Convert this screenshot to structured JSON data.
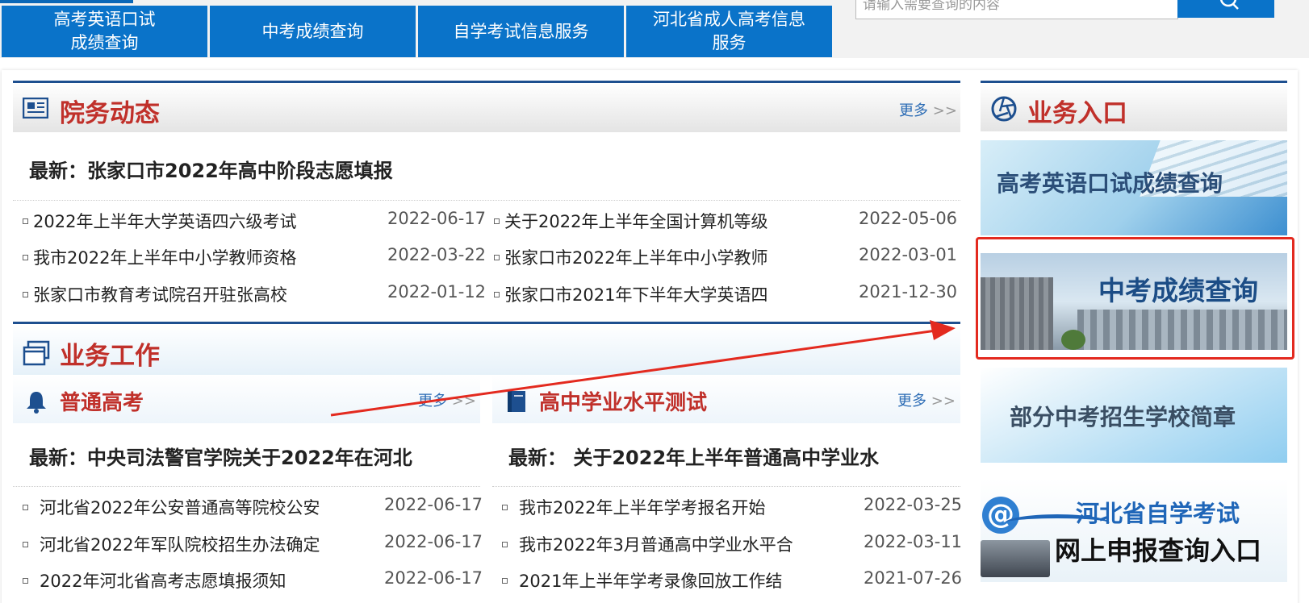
{
  "nav": {
    "items": [
      {
        "label_line1": "高考英语口试",
        "label_line2": "成绩查询"
      },
      {
        "label_line1": "中考成绩查询",
        "label_line2": ""
      },
      {
        "label_line1": "自学考试信息服务",
        "label_line2": ""
      },
      {
        "label_line1": "河北省成人高考信息",
        "label_line2": "服务"
      }
    ],
    "search_placeholder": "请输入需要查询的内容"
  },
  "news_section": {
    "title": "院务动态",
    "more": "更多",
    "latest": "最新：张家口市2022年高中阶段志愿填报",
    "items": [
      {
        "title": "2022年上半年大学英语四六级考试",
        "date": "2022-06-17"
      },
      {
        "title": "关于2022年上半年全国计算机等级",
        "date": "2022-05-06"
      },
      {
        "title": "我市2022年上半年中小学教师资格",
        "date": "2022-03-22"
      },
      {
        "title": "张家口市2022年上半年中小学教师",
        "date": "2022-03-01"
      },
      {
        "title": "张家口市教育考试院召开驻张高校",
        "date": "2022-01-12"
      },
      {
        "title": "张家口市2021年下半年大学英语四",
        "date": "2021-12-30"
      }
    ]
  },
  "work_section": {
    "title": "业务工作",
    "gaokao": {
      "title": "普通高考",
      "more": "更多",
      "latest": "最新：中央司法警官学院关于2022年在河北",
      "items": [
        {
          "title": "河北省2022年公安普通高等院校公安",
          "date": "2022-06-17"
        },
        {
          "title": "河北省2022年军队院校招生办法确定",
          "date": "2022-06-17"
        },
        {
          "title": "2022年河北省高考志愿填报须知",
          "date": "2022-06-17"
        }
      ]
    },
    "xueye": {
      "title": "高中学业水平测试",
      "more": "更多",
      "latest": "最新： 关于2022年上半年普通高中学业水",
      "items": [
        {
          "title": "我市2022年上半年学考报名开始",
          "date": "2022-03-25"
        },
        {
          "title": "我市2022年3月普通高中学业水平合",
          "date": "2022-03-11"
        },
        {
          "title": "2021年上半年学考录像回放工作结",
          "date": "2021-07-26"
        }
      ]
    }
  },
  "entry_section": {
    "title": "业务入口",
    "banners": [
      {
        "label": "高考英语口试成绩查询"
      },
      {
        "label": "中考成绩查询"
      },
      {
        "label": "部分中考招生学校简章"
      },
      {
        "label_line1": "河北省自学考试",
        "label_line2": "网上申报查询入口"
      }
    ]
  },
  "colors": {
    "nav_blue": "#0a73c9",
    "title_red": "#c0302a",
    "link_blue": "#2c6cb5",
    "annotation_red": "#e32a1f"
  }
}
